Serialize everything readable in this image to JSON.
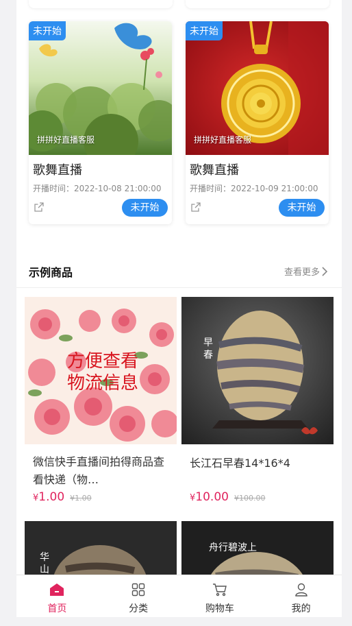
{
  "live_streams": [
    {
      "badge": "未开始",
      "caption": "拼拼好直播客服",
      "title": "歌舞直播",
      "time_label": "开播时间：",
      "time": "2022-10-08 21:00:00",
      "status_button": "未开始"
    },
    {
      "badge": "未开始",
      "caption": "拼拼好直播客服",
      "title": "歌舞直播",
      "time_label": "开播时间：",
      "time": "2022-10-09 21:00:00",
      "status_button": "未开始"
    }
  ],
  "products_section": {
    "title": "示例商品",
    "more_label": "查看更多"
  },
  "products": [
    {
      "image_text_line1": "方便查看",
      "image_text_line2": "物流信息",
      "title": "微信快手直播间拍得商品查看快递（物…",
      "currency": "¥",
      "price": "1.00",
      "old_price": "¥1.00"
    },
    {
      "image_text": "早春",
      "title": "长江石早春14*16*4",
      "currency": "¥",
      "price": "10.00",
      "old_price": "¥100.00"
    }
  ],
  "products_row2": [
    {
      "image_text": "华山"
    },
    {
      "image_text": "舟行碧波上"
    }
  ],
  "tabbar": {
    "items": [
      {
        "label": "首页",
        "icon": "home-icon",
        "active": true
      },
      {
        "label": "分类",
        "icon": "category-grid-icon",
        "active": false
      },
      {
        "label": "购物车",
        "icon": "cart-icon",
        "active": false
      },
      {
        "label": "我的",
        "icon": "user-icon",
        "active": false
      }
    ]
  },
  "colors": {
    "accent_blue": "#2d8ef0",
    "accent_red": "#e0245e"
  }
}
